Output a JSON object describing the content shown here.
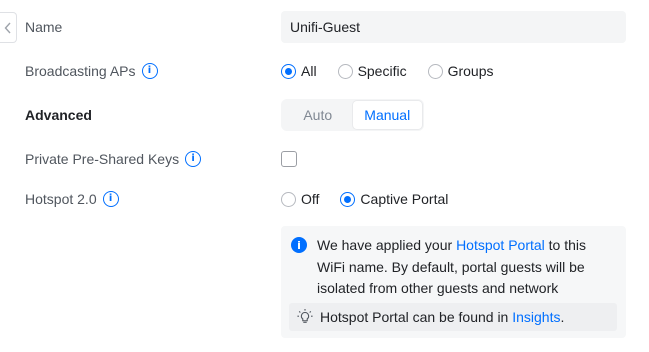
{
  "form": {
    "name": {
      "label": "Name",
      "value": "Unifi-Guest"
    },
    "broadcasting": {
      "label": "Broadcasting APs",
      "options": [
        "All",
        "Specific",
        "Groups"
      ],
      "selected": "All"
    },
    "advanced": {
      "label": "Advanced",
      "options": [
        "Auto",
        "Manual"
      ],
      "selected": "Manual"
    },
    "ppsk": {
      "label": "Private Pre-Shared Keys",
      "checked": false
    },
    "hotspot": {
      "label": "Hotspot 2.0",
      "options": [
        "Off",
        "Captive Portal"
      ],
      "selected": "Captive Portal"
    }
  },
  "notice": {
    "text_pre": "We have applied your ",
    "link": "Hotspot Portal",
    "text_post": " to this WiFi name. By default, portal guests will be isolated from other guests and network resources.",
    "tip_pre": "Hotspot Portal can be found in ",
    "tip_link": "Insights",
    "tip_post": "."
  },
  "icons": {
    "back": "chevron-left-icon",
    "info": "info-icon",
    "notice": "info-filled-icon",
    "tip": "lightbulb-icon"
  },
  "colors": {
    "accent": "#006fff",
    "field_bg": "#f4f5f6",
    "text": "#212327",
    "label": "#50565e"
  }
}
